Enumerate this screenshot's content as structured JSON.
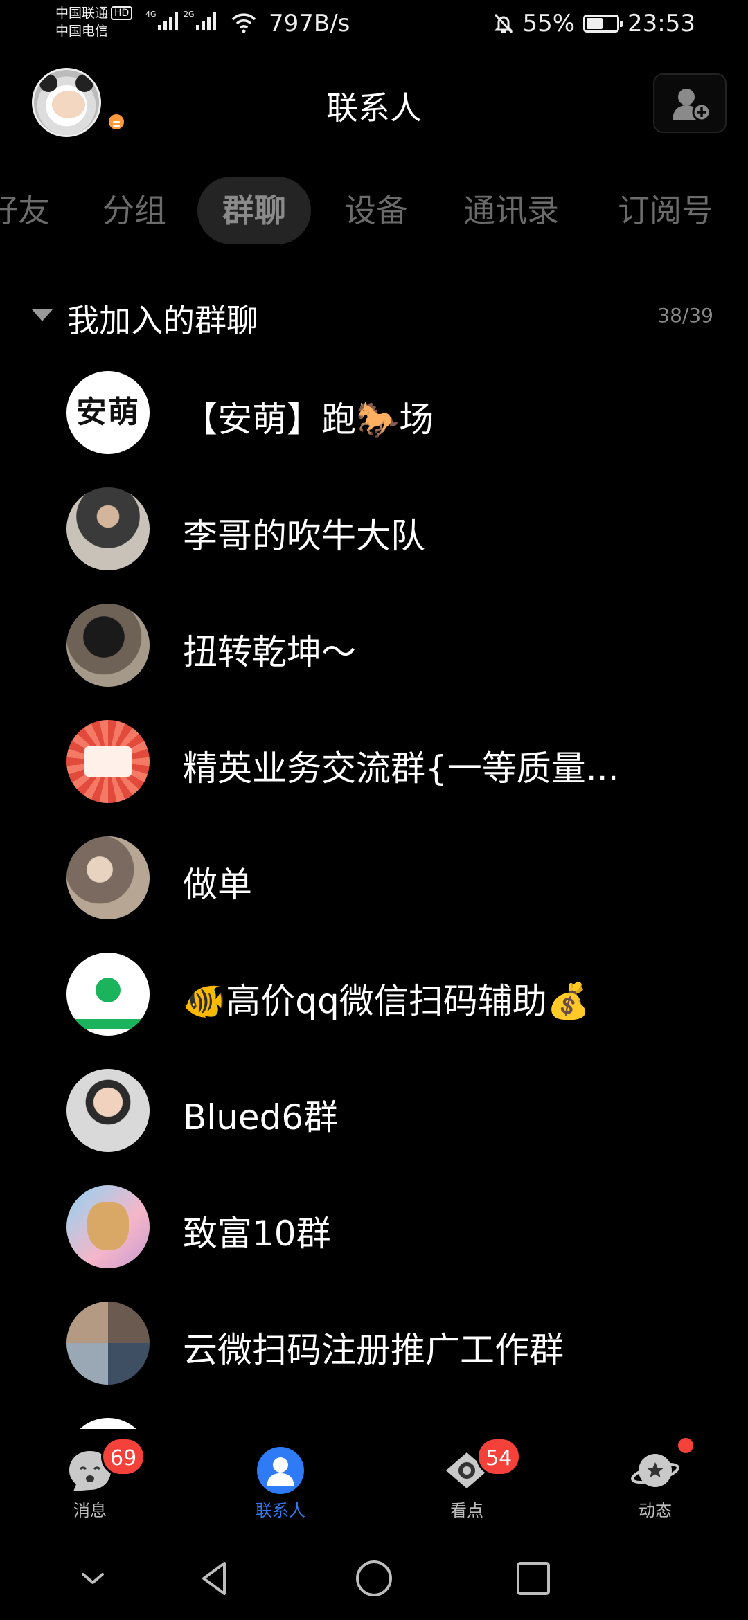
{
  "status_bar": {
    "carrier_1": "中国联通",
    "carrier_1_badge": "HD",
    "carrier_2": "中国电信",
    "signal_1_label": "4G",
    "signal_2_label": "2G",
    "net_speed": "797B/s",
    "battery_percent": "55%",
    "battery_level": 0.55,
    "time": "23:53",
    "icons": [
      "signal-icon",
      "wifi-icon",
      "mute-bell-icon",
      "battery-icon"
    ]
  },
  "header": {
    "title": "联系人",
    "avatar": "panda-avatar",
    "add_contact_icon": "add-contact-icon"
  },
  "tabs": [
    {
      "label": "好友",
      "active": false
    },
    {
      "label": "分组",
      "active": false
    },
    {
      "label": "群聊",
      "active": true
    },
    {
      "label": "设备",
      "active": false
    },
    {
      "label": "通讯录",
      "active": false
    },
    {
      "label": "订阅号",
      "active": false
    }
  ],
  "section": {
    "title": "我加入的群聊",
    "count": "38/39",
    "expanded": true
  },
  "groups": [
    {
      "name": "【安萌】跑🐎场",
      "avatar_text": "安萌"
    },
    {
      "name": "李哥的吹牛大队"
    },
    {
      "name": "扭转乾坤～"
    },
    {
      "name": "精英业务交流群{一等质量..."
    },
    {
      "name": "做单"
    },
    {
      "name": "🐠高价qq微信扫码辅助💰"
    },
    {
      "name": "Blued6群"
    },
    {
      "name": "致富10群"
    },
    {
      "name": "云微扫码注册推广工作群"
    }
  ],
  "bottom_nav": [
    {
      "label": "消息",
      "badge": "69",
      "icon": "message-face-icon"
    },
    {
      "label": "联系人",
      "badge": "",
      "icon": "contacts-person-icon",
      "active": true
    },
    {
      "label": "看点",
      "badge": "54",
      "icon": "eye-icon"
    },
    {
      "label": "动态",
      "badge": "",
      "icon": "planet-star-icon",
      "dot": true
    }
  ],
  "colors": {
    "background": "#000000",
    "active_nav": "#2f7bf5",
    "badge": "#f4423b",
    "tab_active_bg": "#242424",
    "text_secondary": "#8a8a8a"
  }
}
